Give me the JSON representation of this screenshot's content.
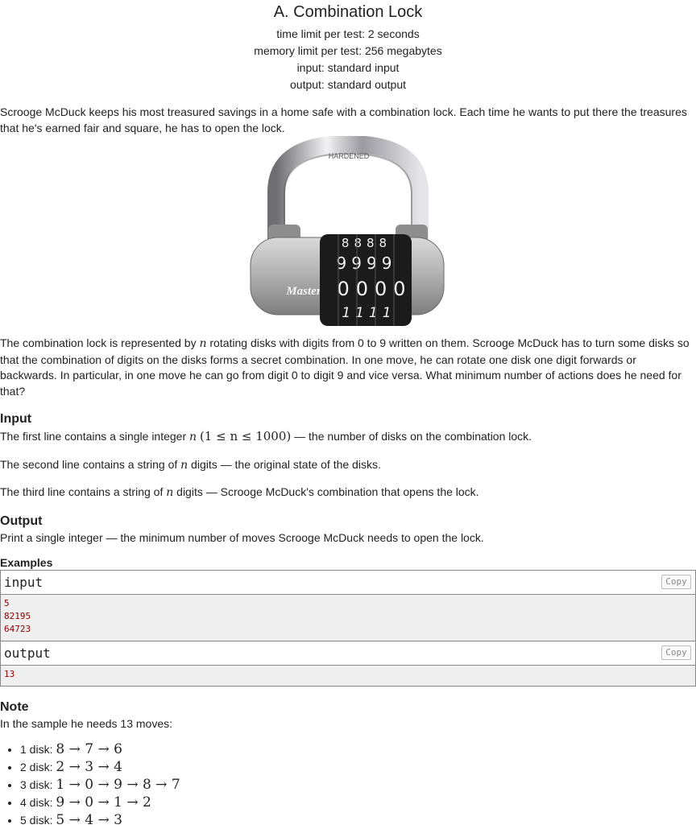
{
  "problem": {
    "title": "A. Combination Lock",
    "time_limit": "time limit per test: 2 seconds",
    "memory_limit": "memory limit per test: 256 megabytes",
    "input_file": "input: standard input",
    "output_file": "output: standard output"
  },
  "legend": {
    "intro": "Scrooge McDuck keeps his most treasured savings in a home safe with a combination lock. Each time he wants to put there the treasures that he's earned fair and square, he has to open the lock.",
    "p2_before": "The combination lock is represented by ",
    "p2_var": "n",
    "p2_after": " rotating disks with digits from 0 to 9 written on them. Scrooge McDuck has to turn some disks so that the combination of digits on the disks forms a secret combination. In one move, he can rotate one disk one digit forwards or backwards. In particular, in one move he can go from digit 0 to digit 9 and vice versa. What minimum number of actions does he need for that?"
  },
  "lock_image": {
    "brand": "Master",
    "shackle_text": "HARDENED",
    "rows": [
      "8888",
      "9999",
      "0000",
      "1111"
    ]
  },
  "input_spec": {
    "title": "Input",
    "l1_before": "The first line contains a single integer ",
    "l1_var": "n",
    "l1_constraint": "(1 ≤ n ≤ 1000)",
    "l1_after": " — the number of disks on the combination lock.",
    "l2_before": "The second line contains a string of ",
    "l2_var": "n",
    "l2_after": " digits — the original state of the disks.",
    "l3_before": "The third line contains a string of ",
    "l3_var": "n",
    "l3_after": " digits — Scrooge McDuck's combination that opens the lock."
  },
  "output_spec": {
    "title": "Output",
    "text": "Print a single integer — the minimum number of moves Scrooge McDuck needs to open the lock."
  },
  "examples": {
    "title": "Examples",
    "input_label": "input",
    "output_label": "output",
    "copy_label": "Copy",
    "input_text": "5\n82195\n64723",
    "output_text": "13"
  },
  "note": {
    "title": "Note",
    "text": "In the sample he needs 13 moves:",
    "items": [
      {
        "label": "1 disk: ",
        "seq": "8 → 7 → 6"
      },
      {
        "label": "2 disk: ",
        "seq": "2 → 3 → 4"
      },
      {
        "label": "3 disk: ",
        "seq": "1 → 0 → 9 → 8 → 7"
      },
      {
        "label": "4 disk: ",
        "seq": "9 → 0 → 1 → 2"
      },
      {
        "label": "5 disk: ",
        "seq": "5 → 4 → 3"
      }
    ]
  }
}
